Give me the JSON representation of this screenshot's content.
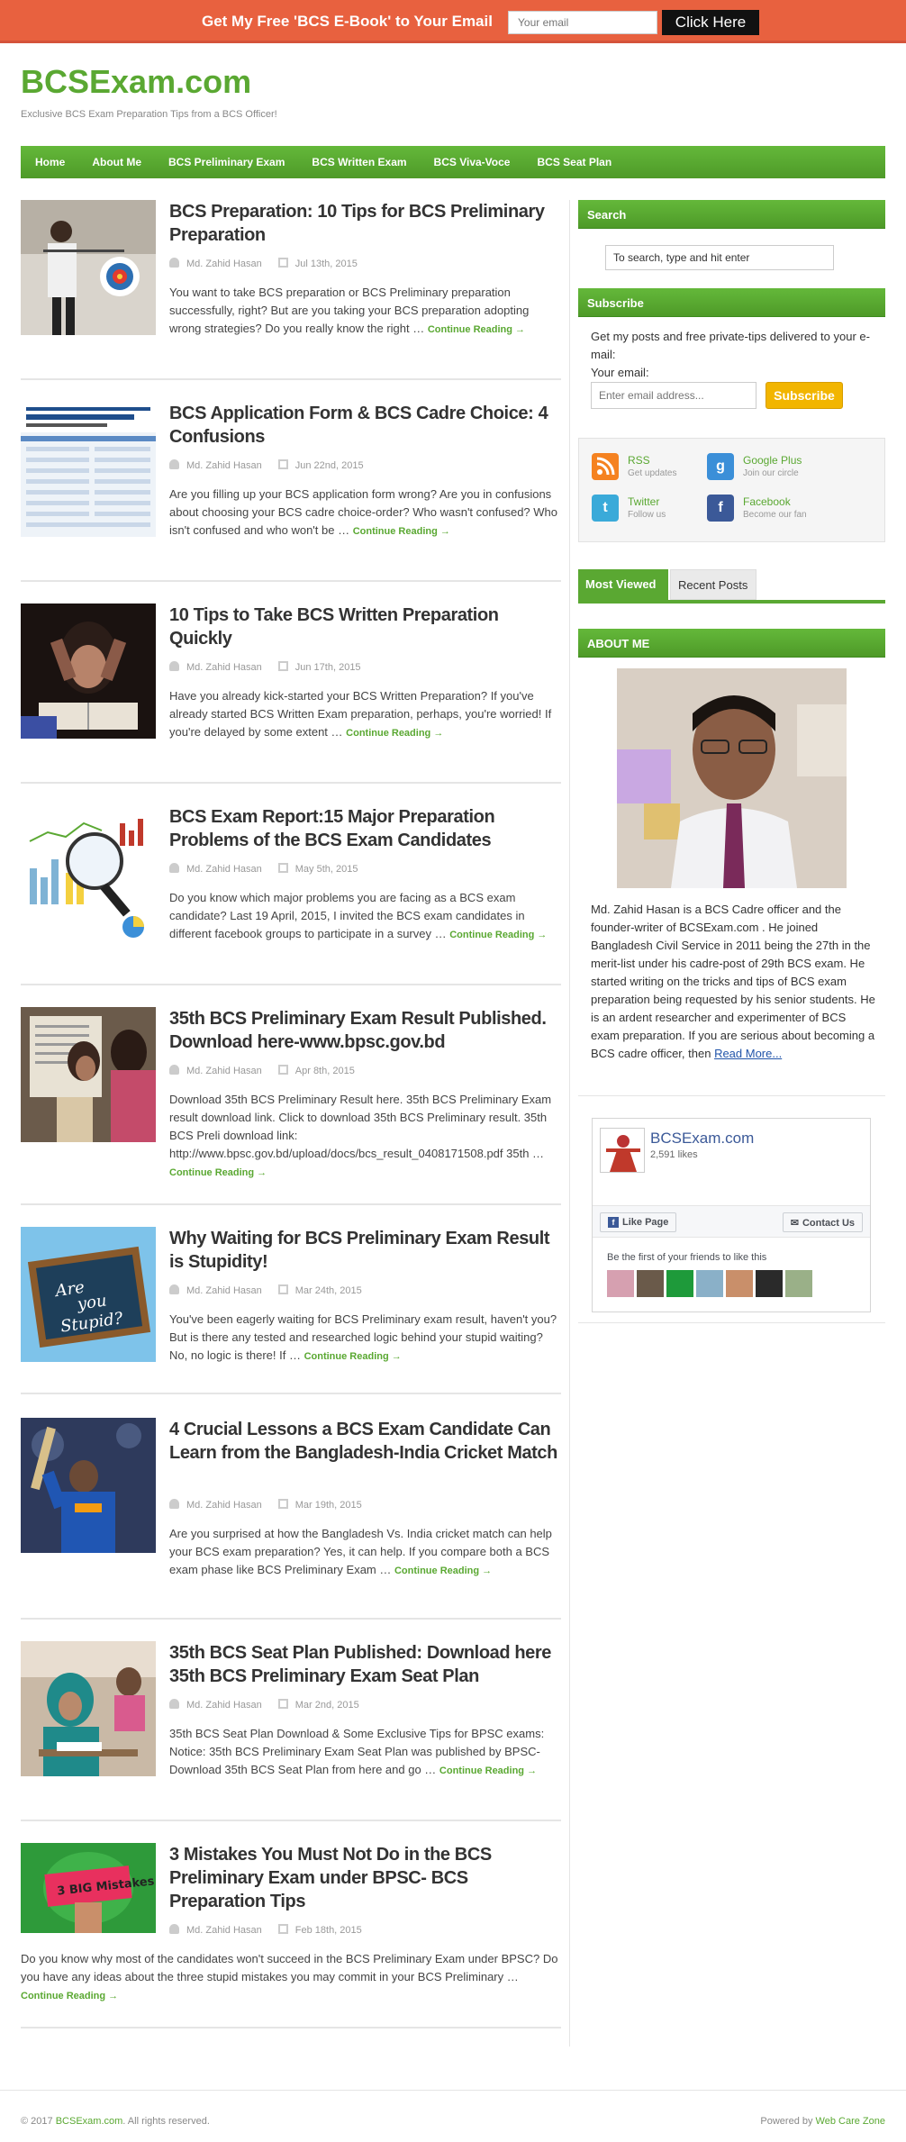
{
  "topbar": {
    "promo": "Get My Free 'BCS E-Book' to Your Email",
    "email_placeholder": "Your email",
    "button": "Click Here",
    "bg_color": "#e8613f"
  },
  "header": {
    "logo": "BCSExam.com",
    "tagline": "Exclusive BCS Exam Preparation Tips from a BCS Officer!",
    "brand_color": "#5aa832"
  },
  "nav": {
    "items": [
      "Home",
      "About Me",
      "BCS Preliminary Exam",
      "BCS Written Exam",
      "BCS Viva-Voce",
      "BCS Seat Plan"
    ]
  },
  "posts": [
    {
      "title": "BCS Preparation: 10 Tips for BCS Preliminary Preparation",
      "author": "Md. Zahid Hasan",
      "date": "Jul 13th, 2015",
      "excerpt": "You want to take BCS preparation or BCS Preliminary preparation successfully, right? But are you taking your BCS preparation adopting wrong strategies? Do you really know the right … ",
      "more": "Continue Reading →"
    },
    {
      "title": "BCS Application Form & BCS Cadre Choice: 4 Confusions",
      "author": "Md. Zahid Hasan",
      "date": "Jun 22nd, 2015",
      "excerpt": "Are you filling up your BCS application form wrong? Are you in confusions about choosing your BCS cadre choice-order? Who wasn't confused? Who isn't confused and who won't be … ",
      "more": "Continue Reading →"
    },
    {
      "title": "10 Tips to Take BCS Written Preparation Quickly",
      "author": "Md. Zahid Hasan",
      "date": "Jun 17th, 2015",
      "excerpt": "Have you already kick-started your BCS Written Preparation?   If you've already started BCS Written Exam preparation, perhaps, you're worried! If you're delayed by some extent … ",
      "more": "Continue Reading →"
    },
    {
      "title": "BCS Exam Report:15 Major Preparation Problems of the BCS Exam Candidates",
      "author": "Md. Zahid Hasan",
      "date": "May 5th, 2015",
      "excerpt": "Do you know which major problems you are facing as a BCS exam candidate? Last 19 April, 2015, I invited the BCS exam candidates in different facebook groups to participate in a survey … ",
      "more": "Continue Reading →"
    },
    {
      "title": "35th BCS Preliminary Exam Result Published. Download here-www.bpsc.gov.bd",
      "author": "Md. Zahid Hasan",
      "date": "Apr 8th, 2015",
      "excerpt": "Download 35th BCS Preliminary Result here. 35th BCS Preliminary Exam result download link. Click to download 35th BCS Preliminary result. 35th BCS Preli download link: http://www.bpsc.gov.bd/upload/docs/bcs_result_0408171508.pdf 35th … ",
      "more": "Continue Reading →"
    },
    {
      "title": "Why Waiting for BCS Preliminary Exam Result is Stupidity!",
      "author": "Md. Zahid Hasan",
      "date": "Mar 24th, 2015",
      "excerpt": "You've been eagerly waiting for BCS Preliminary exam result, haven't you? But is there any tested and researched logic behind your stupid waiting? No, no logic is there! If … ",
      "more": "Continue Reading →"
    },
    {
      "title": "4 Crucial Lessons a BCS Exam Candidate Can Learn from the Bangladesh-India Cricket Match",
      "author": "Md. Zahid Hasan",
      "date": "Mar 19th, 2015",
      "excerpt": "Are you surprised at how the Bangladesh Vs. India cricket match can help your BCS exam preparation? Yes, it can help. If you compare both a BCS exam phase like BCS Preliminary Exam … ",
      "more": "Continue Reading →"
    },
    {
      "title": "35th BCS Seat Plan Published: Download here 35th BCS Preliminary Exam Seat Plan",
      "author": "Md. Zahid Hasan",
      "date": "Mar 2nd, 2015",
      "excerpt": "35th BCS Seat Plan Download & Some Exclusive Tips for BPSC exams: Notice: 35th BCS Preliminary Exam Seat Plan was published by BPSC-Download 35th BCS Seat Plan from here and go … ",
      "more": "Continue Reading →"
    },
    {
      "title": "3 Mistakes You Must Not Do in the BCS Preliminary Exam under BPSC- BCS Preparation Tips",
      "author": "Md. Zahid Hasan",
      "date": "Feb 18th, 2015",
      "excerpt": "Do you know why most of the candidates won't succeed in the BCS Preliminary Exam under BPSC? Do you have any ideas about the three stupid mistakes you may commit in your BCS Preliminary … ",
      "more": "Continue Reading →"
    }
  ],
  "sidebar": {
    "search": {
      "title": "Search",
      "placeholder": "To search, type and hit enter"
    },
    "subscribe": {
      "title": "Subscribe",
      "text": "Get my posts and free private-tips delivered to your e-mail:",
      "label": "Your email:",
      "placeholder": "Enter email address...",
      "button": "Subscribe"
    },
    "social": [
      {
        "name": "RSS",
        "sub": "Get updates",
        "icon": "rss-icon",
        "color": "#f58220"
      },
      {
        "name": "Google Plus",
        "sub": "Join our circle",
        "icon": "google-plus-icon",
        "color": "#3b8fd8"
      },
      {
        "name": "Twitter",
        "sub": "Follow us",
        "icon": "twitter-icon",
        "color": "#3aaad9"
      },
      {
        "name": "Facebook",
        "sub": "Become our fan",
        "icon": "facebook-icon",
        "color": "#3b5998"
      }
    ],
    "tabs": [
      "Most Viewed",
      "Recent Posts"
    ],
    "about": {
      "title": "ABOUT ME",
      "text": "Md. Zahid Hasan is a BCS Cadre officer and the founder-writer of BCSExam.com . He joined Bangladesh Civil Service in 2011 being the 27th in the merit-list under his cadre-post of 29th BCS exam. He started writing on the tricks and tips of BCS exam preparation being requested by his senior students. He is an ardent researcher and experimenter of BCS exam preparation. If you are serious about becoming a BCS cadre officer, then ",
      "read_more": "Read More..."
    },
    "facebook": {
      "page_name": "BCSExam.com",
      "likes": "2,591 likes",
      "like_button": "Like Page",
      "contact_button": "Contact Us",
      "friends_text": "Be the first of your friends to like this"
    }
  },
  "footer": {
    "copyright_prefix": "© 2017 ",
    "copyright_link": "BCSExam.com",
    "copyright_suffix": ". All rights reserved.",
    "powered_prefix": "Powered by ",
    "powered_link": "Web Care Zone"
  }
}
